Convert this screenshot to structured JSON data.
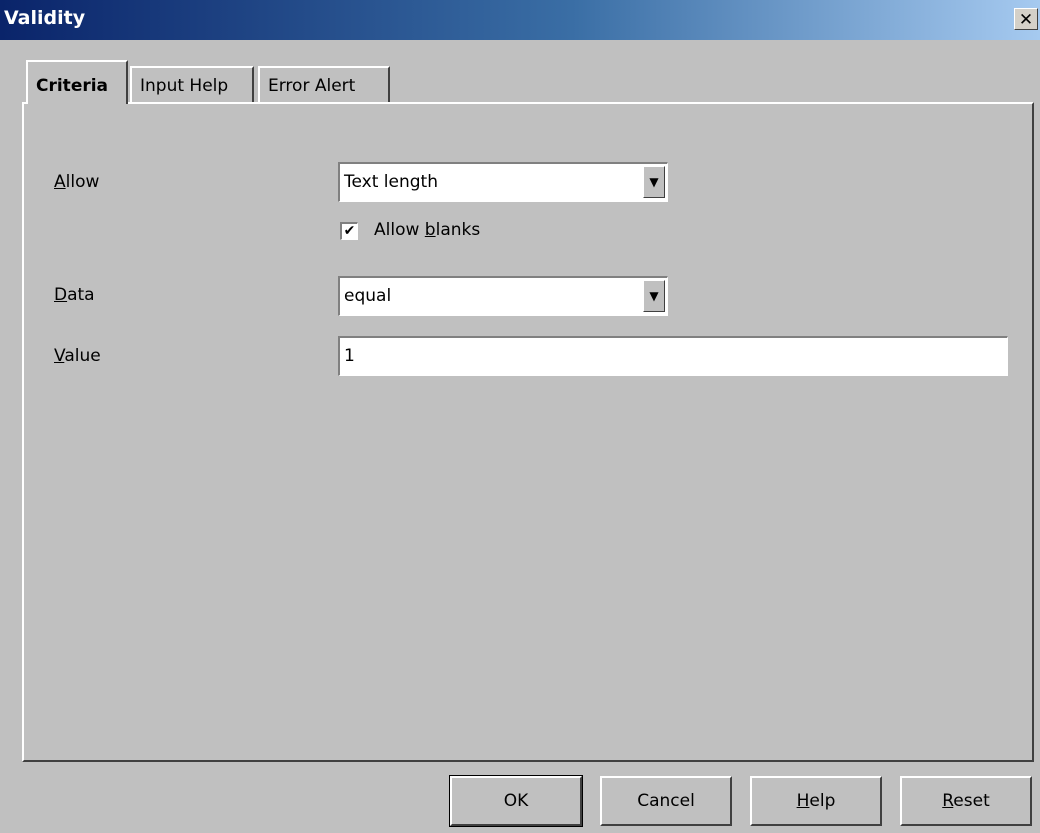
{
  "window": {
    "title": "Validity",
    "close_glyph": "✕"
  },
  "tabs": [
    {
      "label": "Criteria",
      "active": true
    },
    {
      "label": "Input Help",
      "active": false
    },
    {
      "label": "Error Alert",
      "active": false
    }
  ],
  "criteria": {
    "allow": {
      "label_mnemonic": "A",
      "label_rest": "llow",
      "selected": "Text length",
      "arrow_glyph": "▼"
    },
    "allow_blanks": {
      "checked": true,
      "check_glyph": "✔",
      "label_prefix": "Allow ",
      "label_mnemonic": "b",
      "label_rest": "lanks"
    },
    "data": {
      "label_mnemonic": "D",
      "label_rest": "ata",
      "selected": "equal",
      "arrow_glyph": "▼"
    },
    "value": {
      "label_mnemonic": "V",
      "label_rest": "alue",
      "text": "1"
    }
  },
  "buttons": {
    "ok": "OK",
    "cancel": "Cancel",
    "help_mnemonic": "H",
    "help_rest": "elp",
    "reset_mnemonic": "R",
    "reset_rest": "eset"
  }
}
